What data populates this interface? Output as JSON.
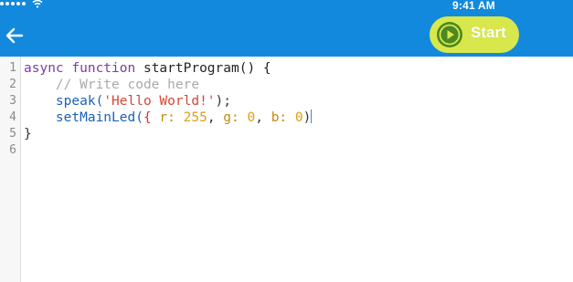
{
  "status_bar": {
    "time": "9:41 AM",
    "signal_icon": "signal-dots-icon",
    "wifi_icon": "wifi-icon"
  },
  "header": {
    "back_icon": "back-arrow-icon",
    "start_label": "Start",
    "start_icon": "play-icon"
  },
  "colors": {
    "header_bg": "#1289dc",
    "start_button_bg": "#d8e84c",
    "start_circle_bg": "#4c8722"
  },
  "editor": {
    "line_numbers": [
      "1",
      "2",
      "3",
      "4",
      "5",
      "6"
    ],
    "line1": {
      "async": "async",
      "function": "function",
      "name": "startProgram() {"
    },
    "line2": {
      "comment": "// Write code here"
    },
    "line3": {
      "call": "speak(",
      "string": "'Hello World!'",
      "end": ");"
    },
    "line4": {
      "call": "setMainLed(",
      "open": "{",
      "r_key": "r:",
      "r_val": "255",
      "g_key": "g:",
      "g_val": "0",
      "b_key": "b:",
      "b_val": "0",
      "close": ")",
      "sep": ","
    },
    "line5": {
      "close_brace": "}"
    }
  }
}
